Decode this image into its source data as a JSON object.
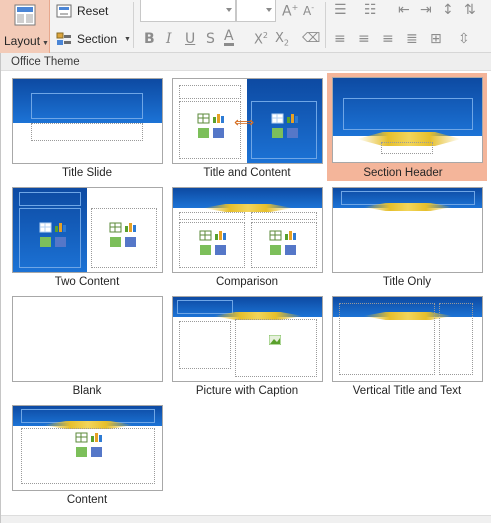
{
  "ribbon": {
    "layout_label": "Layout",
    "reset_label": "Reset",
    "section_label": "Section"
  },
  "gallery": {
    "theme_header": "Office Theme",
    "layouts": [
      {
        "name": "Title Slide",
        "selected": false
      },
      {
        "name": "Title and Content",
        "selected": false
      },
      {
        "name": "Section Header",
        "selected": true
      },
      {
        "name": "Two Content",
        "selected": false
      },
      {
        "name": "Comparison",
        "selected": false
      },
      {
        "name": "Title Only",
        "selected": false
      },
      {
        "name": "Blank",
        "selected": false
      },
      {
        "name": "Picture with Caption",
        "selected": false
      },
      {
        "name": "Vertical Title and Text",
        "selected": false
      },
      {
        "name": "Content",
        "selected": false
      }
    ]
  },
  "colors": {
    "theme_blue": "#1c73d6",
    "selection": "#f4b59a",
    "flare_gold": "#e6bf2c"
  }
}
